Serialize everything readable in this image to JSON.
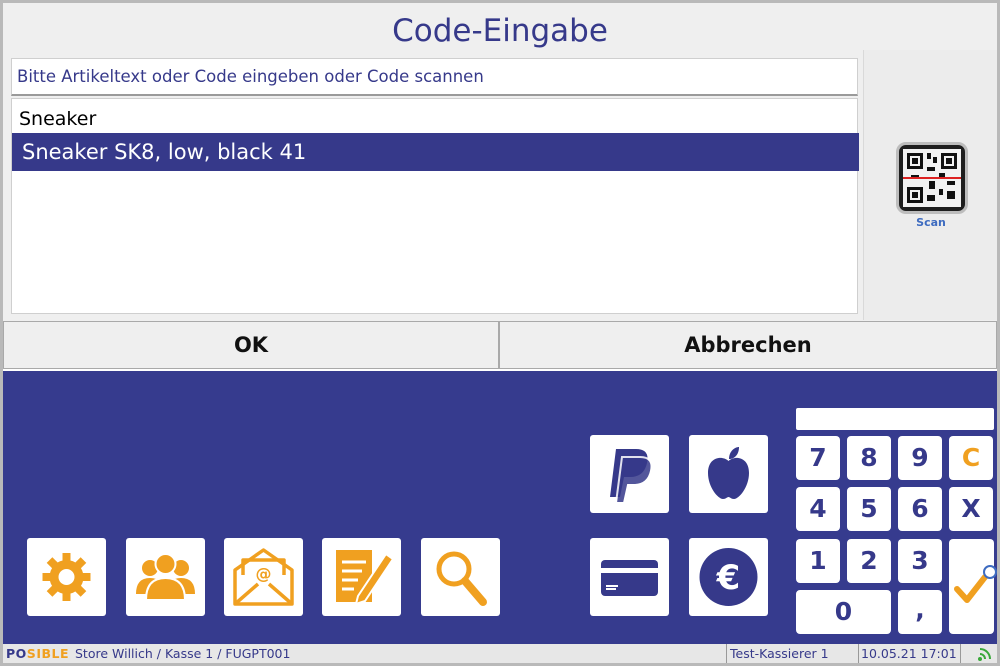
{
  "dialog": {
    "title": "Code-Eingabe",
    "input_placeholder": "Bitte Artikeltext oder Code eingeben oder Code scannen",
    "list_header": "Sneaker",
    "list_items": [
      "Sneaker SK8, low, black 41"
    ],
    "scan_label": "Scan",
    "ok_label": "OK",
    "cancel_label": "Abbrechen"
  },
  "app": {
    "function_icons": [
      "settings-icon",
      "customers-icon",
      "email-icon",
      "notes-icon",
      "search-icon"
    ],
    "payment_icons": [
      "paypal-icon",
      "apple-pay-icon",
      "card-icon",
      "euro-cash-icon"
    ],
    "keypad": {
      "display": "",
      "keys": [
        "7",
        "8",
        "9",
        "C",
        "4",
        "5",
        "6",
        "X",
        "1",
        "2",
        "3",
        "0",
        ","
      ],
      "confirm_icon": "checkmark-icon"
    }
  },
  "statusbar": {
    "logo_prefix": "PO",
    "logo_s": "S",
    "logo_suffix": "IBLE",
    "store": "Store Willich / Kasse 1 / FUGPT001",
    "cashier": "Test-Kassierer 1",
    "datetime": "10.05.21 17:01"
  },
  "colors": {
    "brand_blue": "#36398a",
    "accent_orange": "#f0a020"
  }
}
